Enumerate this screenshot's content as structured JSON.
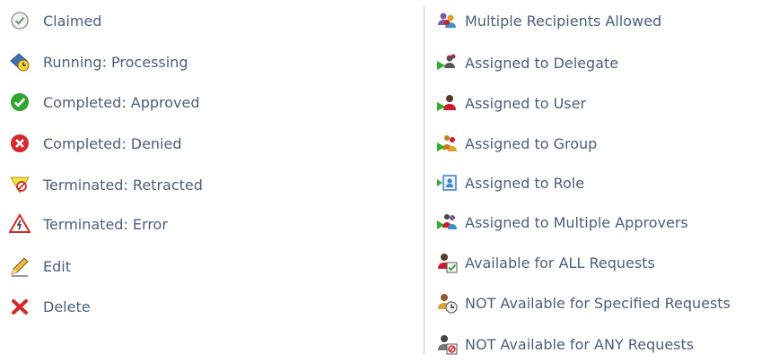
{
  "left_column": {
    "items": [
      {
        "label": "Claimed",
        "icon": "claimed-check-icon"
      },
      {
        "label": "Running: Processing",
        "icon": "running-processing-icon"
      },
      {
        "label": "Completed: Approved",
        "icon": "approved-check-icon"
      },
      {
        "label": "Completed: Denied",
        "icon": "denied-x-icon"
      },
      {
        "label": "Terminated: Retracted",
        "icon": "retracted-icon"
      },
      {
        "label": "Terminated: Error",
        "icon": "error-warning-icon"
      },
      {
        "label": "Edit",
        "icon": "pencil-icon"
      },
      {
        "label": "Delete",
        "icon": "delete-x-icon"
      }
    ]
  },
  "right_column": {
    "items": [
      {
        "label": "Multiple Recipients Allowed",
        "icon": "multiple-recipients-icon"
      },
      {
        "label": "Assigned to Delegate",
        "icon": "delegate-icon"
      },
      {
        "label": "Assigned to User",
        "icon": "user-icon"
      },
      {
        "label": "Assigned to Group",
        "icon": "group-icon"
      },
      {
        "label": "Assigned to Role",
        "icon": "role-icon"
      },
      {
        "label": "Assigned to Multiple Approvers",
        "icon": "multiple-approvers-icon"
      },
      {
        "label": "Available for ALL Requests",
        "icon": "available-all-icon"
      },
      {
        "label": "NOT Available for Specified Requests",
        "icon": "not-available-specified-icon"
      },
      {
        "label": "NOT Available for ANY Requests",
        "icon": "not-available-any-icon"
      }
    ]
  },
  "colors": {
    "text": "#4a5f7a",
    "divider": "#c8c8c8",
    "approved_green": "#2ea52e",
    "denied_red": "#d42a2a",
    "flag_green": "#2bb02b",
    "person_red": "#c8202a"
  }
}
